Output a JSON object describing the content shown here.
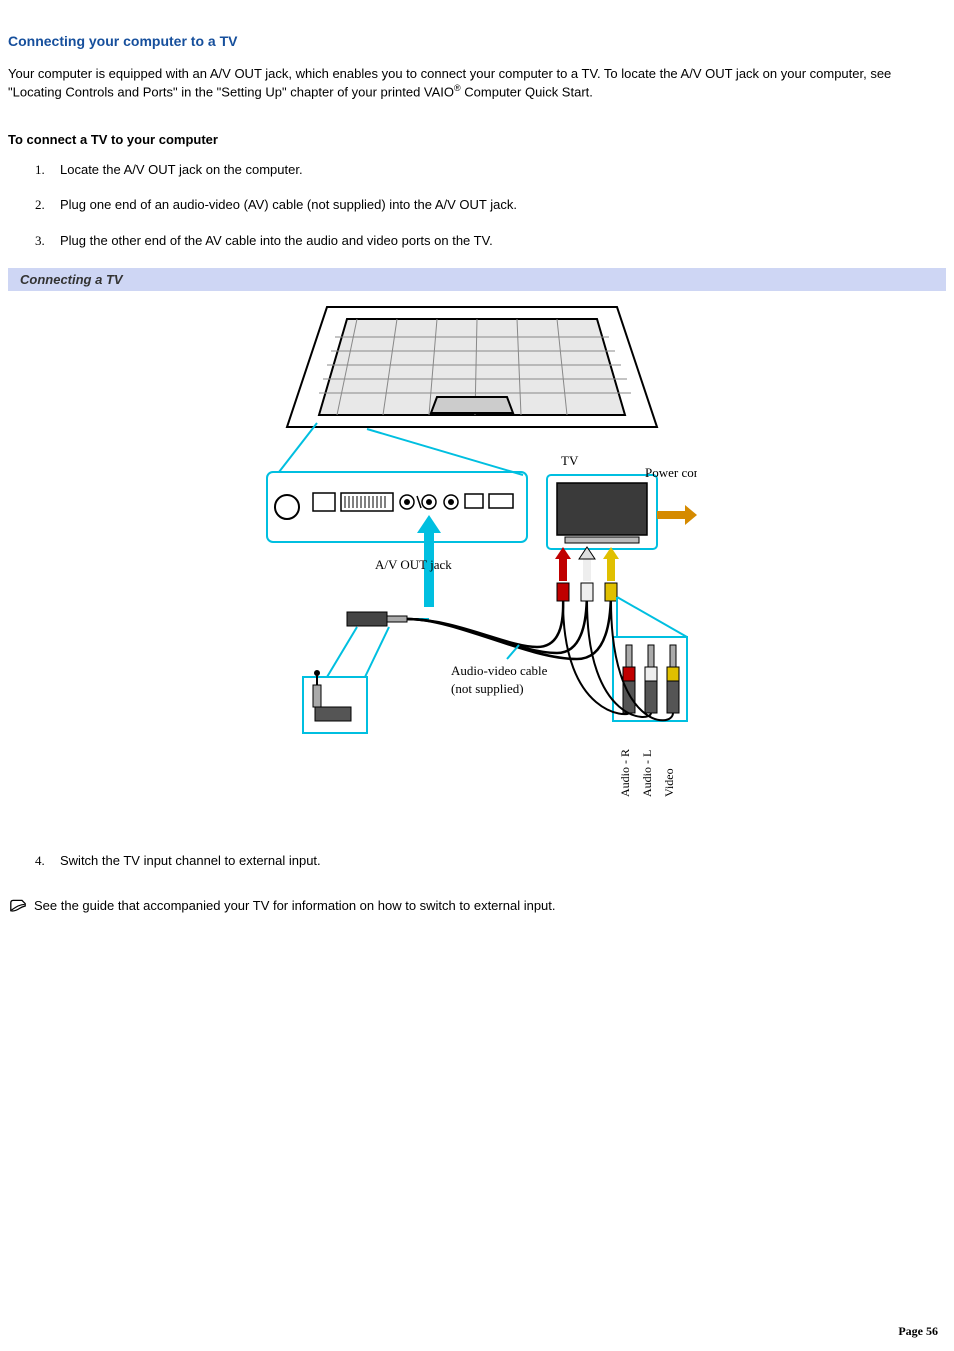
{
  "title": "Connecting your computer to a TV",
  "intro": {
    "part1": "Your computer is equipped with an A/V OUT jack, which enables you to connect your computer to a TV. To locate the A/V OUT jack on your computer, see \"Locating Controls and Ports\" in the \"Setting Up\" chapter of your printed VAIO",
    "reg": "®",
    "part2": " Computer Quick Start."
  },
  "subhead": "To connect a TV to your computer",
  "steps": [
    "Locate the A/V OUT jack on the computer.",
    "Plug one end of an audio-video (AV) cable (not supplied) into the A/V OUT jack.",
    "Plug the other end of the AV cable into the audio and video ports on the TV."
  ],
  "figcaption": "Connecting a TV",
  "figure": {
    "tv": "TV",
    "powercord": "Power cord",
    "avout": "A/V OUT jack",
    "cable1": "Audio-video cable",
    "cable2": "(not supplied)",
    "audioR": "Audio - R",
    "audioL": "Audio - L",
    "video": "Video"
  },
  "steps2": [
    "Switch the TV input channel to external input."
  ],
  "note": "See the guide that accompanied your TV for information on how to switch to external input.",
  "pagenum_label": "Page ",
  "pagenum": "56"
}
